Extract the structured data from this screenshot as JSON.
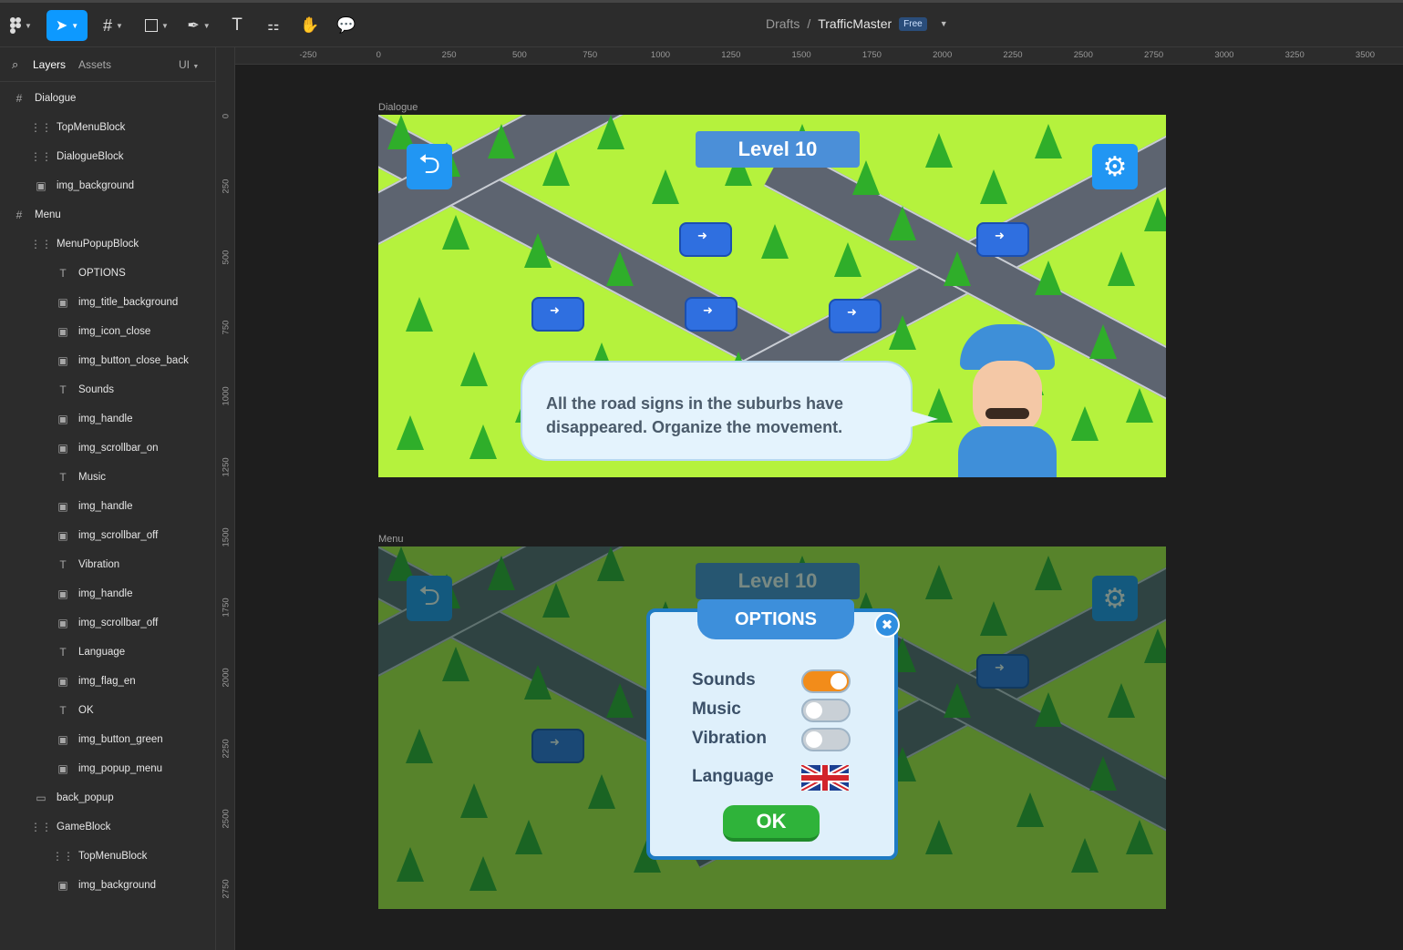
{
  "toolbar": {
    "breadcrumb_root": "Drafts",
    "breadcrumb_sep": "/",
    "file_name": "TrafficMaster",
    "plan_badge": "Free",
    "icons": [
      "figma-logo-icon",
      "move-icon",
      "frame-icon",
      "shape-icon",
      "pen-icon",
      "text-icon",
      "components-icon",
      "hand-icon",
      "comment-icon"
    ]
  },
  "sidebar": {
    "tab_layers": "Layers",
    "tab_assets": "Assets",
    "page_selector": "UI",
    "layers": [
      {
        "label": "Dialogue",
        "icon": "#",
        "indent": 0
      },
      {
        "label": "TopMenuBlock",
        "icon": "⋮⋮",
        "indent": 1
      },
      {
        "label": "DialogueBlock",
        "icon": "⋮⋮",
        "indent": 1
      },
      {
        "label": "img_background",
        "icon": "▣",
        "indent": 1
      },
      {
        "label": "Menu",
        "icon": "#",
        "indent": 0
      },
      {
        "label": "MenuPopupBlock",
        "icon": "⋮⋮",
        "indent": 1
      },
      {
        "label": "OPTIONS",
        "icon": "T",
        "indent": 2
      },
      {
        "label": "img_title_background",
        "icon": "▣",
        "indent": 2
      },
      {
        "label": "img_icon_close",
        "icon": "▣",
        "indent": 2
      },
      {
        "label": "img_button_close_back",
        "icon": "▣",
        "indent": 2
      },
      {
        "label": "Sounds",
        "icon": "T",
        "indent": 2
      },
      {
        "label": "img_handle",
        "icon": "▣",
        "indent": 2
      },
      {
        "label": "img_scrollbar_on",
        "icon": "▣",
        "indent": 2
      },
      {
        "label": "Music",
        "icon": "T",
        "indent": 2
      },
      {
        "label": "img_handle",
        "icon": "▣",
        "indent": 2
      },
      {
        "label": "img_scrollbar_off",
        "icon": "▣",
        "indent": 2
      },
      {
        "label": "Vibration",
        "icon": "T",
        "indent": 2
      },
      {
        "label": "img_handle",
        "icon": "▣",
        "indent": 2
      },
      {
        "label": "img_scrollbar_off",
        "icon": "▣",
        "indent": 2
      },
      {
        "label": "Language",
        "icon": "T",
        "indent": 2
      },
      {
        "label": "img_flag_en",
        "icon": "▣",
        "indent": 2
      },
      {
        "label": "OK",
        "icon": "T",
        "indent": 2
      },
      {
        "label": "img_button_green",
        "icon": "▣",
        "indent": 2
      },
      {
        "label": "img_popup_menu",
        "icon": "▣",
        "indent": 2
      },
      {
        "label": "back_popup",
        "icon": "▭",
        "indent": 1
      },
      {
        "label": "GameBlock",
        "icon": "⋮⋮",
        "indent": 1
      },
      {
        "label": "TopMenuBlock",
        "icon": "⋮⋮",
        "indent": 2
      },
      {
        "label": "img_background",
        "icon": "▣",
        "indent": 2
      }
    ]
  },
  "rulers": {
    "top": [
      "-250",
      "0",
      "250",
      "500",
      "750",
      "1000",
      "1250",
      "1500",
      "1750",
      "2000",
      "2250",
      "2500",
      "2750",
      "3000",
      "3250",
      "3500"
    ],
    "left": [
      "0",
      "250",
      "500",
      "750",
      "1000",
      "1250",
      "1500",
      "1750",
      "2000",
      "2250",
      "2500",
      "2750"
    ]
  },
  "frames": {
    "dialogue_label": "Dialogue",
    "menu_label": "Menu",
    "level_text": "Level 10",
    "dialogue_text": "All the road signs in the suburbs have disappeared. Organize the movement.",
    "options_title": "OPTIONS",
    "options": [
      {
        "label": "Sounds",
        "on": true
      },
      {
        "label": "Music",
        "on": false
      },
      {
        "label": "Vibration",
        "on": false
      }
    ],
    "language_label": "Language",
    "ok_label": "OK"
  },
  "colors": {
    "accent": "#0d99ff",
    "grass": "#b5f23d",
    "toggle_on": "#f28c1a",
    "toggle_off": "#c9d0d6",
    "ok_green": "#2fb33a"
  }
}
